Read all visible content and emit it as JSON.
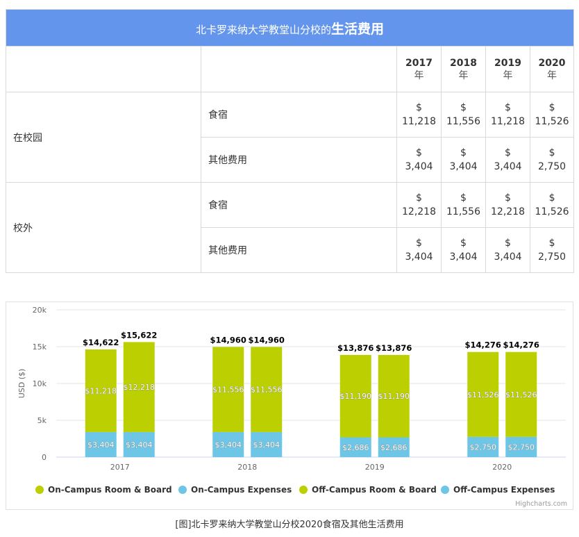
{
  "table": {
    "title_prefix": "北卡罗来纳大学教堂山分校的",
    "title_highlight": "生活费用",
    "year_unit": "年",
    "years": [
      "2017",
      "2018",
      "2019",
      "2020"
    ],
    "groups": [
      {
        "label": "在校园",
        "rows": [
          {
            "item": "食宿",
            "values": [
              "11,218",
              "11,556",
              "11,218",
              "11,526"
            ]
          },
          {
            "item": "其他费用",
            "values": [
              "3,404",
              "3,404",
              "3,404",
              "2,750"
            ]
          }
        ]
      },
      {
        "label": "校外",
        "rows": [
          {
            "item": "食宿",
            "values": [
              "12,218",
              "11,556",
              "12,218",
              "11,526"
            ]
          },
          {
            "item": "其他费用",
            "values": [
              "3,404",
              "3,404",
              "3,404",
              "2,750"
            ]
          }
        ]
      }
    ],
    "currency": "$"
  },
  "chart_data": {
    "type": "bar",
    "stacked": true,
    "categories": [
      "2017",
      "2018",
      "2019",
      "2020"
    ],
    "ylabel": "USD ($)",
    "ylim": [
      0,
      20000
    ],
    "yticks": [
      0,
      5000,
      10000,
      15000,
      20000
    ],
    "ytick_labels": [
      "0",
      "5k",
      "10k",
      "15k",
      "20k"
    ],
    "stacks": [
      {
        "name": "On-Campus",
        "totals": [
          "$14,622",
          "$14,960",
          "$13,876",
          "$14,276"
        ],
        "segments": [
          {
            "series": "On-Campus Expenses",
            "values": [
              3404,
              3404,
              2686,
              2750
            ]
          },
          {
            "series": "On-Campus Room & Board",
            "values": [
              11218,
              11556,
              11190,
              11526
            ]
          }
        ]
      },
      {
        "name": "Off-Campus",
        "totals": [
          "$15,622",
          "$14,960",
          "$13,876",
          "$14,276"
        ],
        "segments": [
          {
            "series": "Off-Campus Expenses",
            "values": [
              3404,
              3404,
              2686,
              2750
            ]
          },
          {
            "series": "Off-Campus Room & Board",
            "values": [
              12218,
              11556,
              11190,
              11526
            ]
          }
        ]
      }
    ],
    "legend": [
      {
        "name": "On-Campus Room & Board",
        "color": "#bccf00"
      },
      {
        "name": "On-Campus Expenses",
        "color": "#6ec6e6"
      },
      {
        "name": "Off-Campus Room & Board",
        "color": "#bccf00"
      },
      {
        "name": "Off-Campus Expenses",
        "color": "#6ec6e6"
      }
    ],
    "legend_position": "bottom",
    "colors": {
      "room_board": "#bccf00",
      "expenses": "#6ec6e6",
      "grid": "#e6e6e6"
    },
    "credits": "Highcharts.com"
  },
  "caption": "[图]北卡罗来纳大学教堂山分校2020食宿及其他生活费用"
}
